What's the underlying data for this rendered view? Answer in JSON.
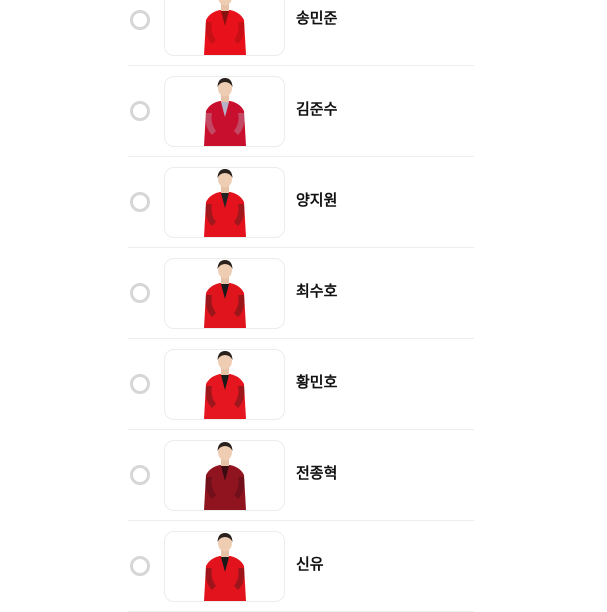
{
  "candidates": [
    {
      "name": "송민준",
      "outfit": "#e8101a",
      "accent": "#8a1010",
      "selected": false
    },
    {
      "name": "김준수",
      "outfit": "#c8102e",
      "accent": "#b8b2c8",
      "selected": false
    },
    {
      "name": "양지원",
      "outfit": "#e3121c",
      "accent": "#222222",
      "selected": false
    },
    {
      "name": "최수호",
      "outfit": "#e0141d",
      "accent": "#1a1a1a",
      "selected": false
    },
    {
      "name": "황민호",
      "outfit": "#e5161f",
      "accent": "#1a1a1a",
      "selected": false
    },
    {
      "name": "전종혁",
      "outfit": "#8f1420",
      "accent": "#3a0a10",
      "selected": false
    },
    {
      "name": "신유",
      "outfit": "#e3131d",
      "accent": "#1a1a1a",
      "selected": false
    }
  ],
  "colors": {
    "radio_border": "#d6d6d6",
    "divider": "#eeeeee",
    "text": "#111111"
  }
}
